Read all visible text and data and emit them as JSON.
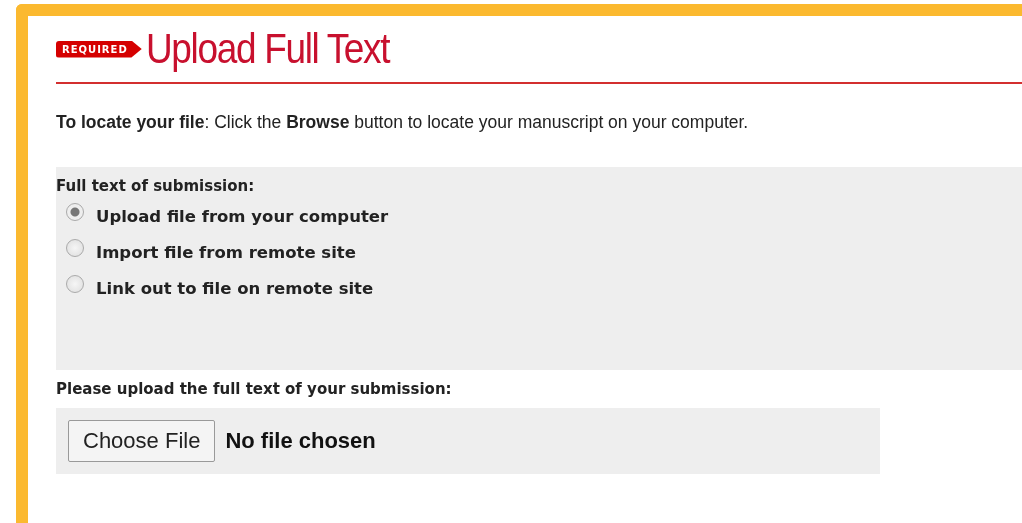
{
  "heading": {
    "badge": "REQUIRED",
    "title": "Upload Full Text"
  },
  "instruction": "**To locate your file**: Click the **Browse** button to locate your manuscript on your computer.",
  "full_text_options": {
    "label": "Full text of submission:",
    "options": [
      {
        "label": "Upload file from your computer",
        "selected": true
      },
      {
        "label": "Import file from remote site",
        "selected": false
      },
      {
        "label": "Link out to file on remote site",
        "selected": false
      }
    ]
  },
  "upload": {
    "label": "Please upload the full text of your submission:",
    "button": "Choose File",
    "status": "No file chosen"
  }
}
